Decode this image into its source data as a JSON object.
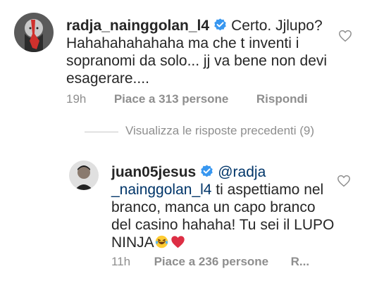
{
  "comments": [
    {
      "username": "radja_nainggolan_l4",
      "text": "Certo. Jjlupo? Hahahahahahaha ma che t inventi i sopranomi da solo... jj va bene non devi esagerare....",
      "time": "19h",
      "likes": "Piace a 313 persone",
      "reply": "Rispondi",
      "avatar_icon": "bearded-man-red-art-avatar",
      "verified_icon": "verified-badge-icon"
    }
  ],
  "view_replies": "Visualizza le risposte precedenti (9)",
  "reply": {
    "username": "juan05jesus",
    "mention": "@radja _nainggolan_l4",
    "text": " ti aspettiamo nel branco, manca un capo branco del casino hahaha! Tu sei il LUPO NINJA",
    "emojis": [
      "😂",
      "❤️"
    ],
    "time": "11h",
    "likes": "Piace a 236 persone",
    "reply_truncated": "R...",
    "avatar_icon": "man-portrait-avatar"
  },
  "colors": {
    "text": "#262626",
    "meta": "#8e8e8e",
    "mention": "#003569",
    "verified": "#3897f0"
  }
}
